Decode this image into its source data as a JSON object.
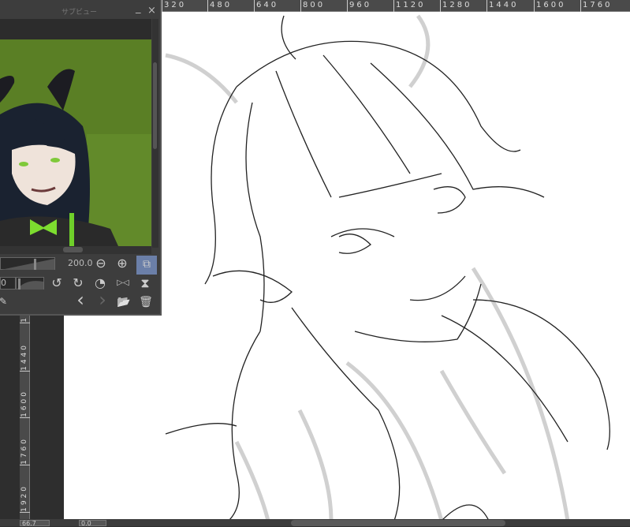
{
  "ruler": {
    "top": [
      "320",
      "480",
      "640",
      "800",
      "960",
      "1120",
      "1280",
      "1440",
      "1600",
      "1760"
    ],
    "left": [
      "1",
      "1440",
      "1600",
      "1760",
      "1920"
    ]
  },
  "subview": {
    "title": "サブビュー",
    "minimize": "_",
    "close": "×",
    "zoom_value": "200.0",
    "rotation_value": "0",
    "icons": {
      "zoom_out": "⊖",
      "zoom_in": "⊕",
      "fit": "⧉",
      "rotate_left": "↺",
      "rotate_right": "↻",
      "reset_rotation": "◔",
      "flip_h": "▷◁",
      "flip_v": "⧗",
      "prev": "‹",
      "next": "›",
      "open": "📂",
      "delete": "🗑",
      "eyedropper": "✎"
    }
  },
  "status": {
    "zoom": "66.7",
    "angle": "0.0"
  },
  "colors": {
    "accent": "#6b7fa8",
    "preview_bg": "#5a7f25"
  }
}
